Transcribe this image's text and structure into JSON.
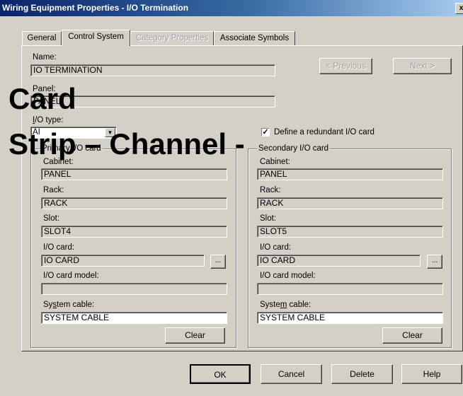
{
  "window": {
    "title": "Wiring Equipment Properties - I/O Termination",
    "close_glyph": "x"
  },
  "tabs": [
    {
      "label": "General",
      "state": "normal"
    },
    {
      "label": "Control System",
      "state": "active"
    },
    {
      "label": "Category Properties",
      "state": "disabled"
    },
    {
      "label": "Associate Symbols",
      "state": "normal"
    }
  ],
  "form": {
    "name_label": "Name:",
    "name_value": "IO TERMINATION",
    "panel_label": "Panel:",
    "panel_value": "PANEL",
    "io_type_label": "I/O type:",
    "io_type_value": "AI",
    "redundant_checkbox_label": "Define a redundant I/O card",
    "redundant_checked": true,
    "previous_button": "< Previous",
    "next_button": "Next >"
  },
  "primary": {
    "legend": "Primary I/O card",
    "cabinet_label": "Cabinet:",
    "cabinet_value": "PANEL",
    "rack_label": "Rack:",
    "rack_value": "RACK",
    "slot_label": "Slot:",
    "slot_value": "SLOT4",
    "io_card_label": "I/O card:",
    "io_card_value": "IO CARD",
    "io_card_model_label": "I/O card model:",
    "io_card_model_value": "",
    "system_cable_label": "System cable:",
    "system_cable_value": "SYSTEM CABLE",
    "browse_button": "...",
    "clear_button": "Clear"
  },
  "secondary": {
    "legend": "Secondary I/O card",
    "cabinet_label": "Cabinet:",
    "cabinet_value": "PANEL",
    "rack_label": "Rack:",
    "rack_value": "RACK",
    "slot_label": "Slot:",
    "slot_value": "SLOT5",
    "io_card_label": "I/O card:",
    "io_card_value": "IO CARD",
    "io_card_model_label": "I/O card model:",
    "io_card_model_value": "",
    "system_cable_label": "System cable:",
    "system_cable_value": "SYSTEM CABLE",
    "browse_button": "...",
    "clear_button": "Clear"
  },
  "footer": {
    "ok_button": "OK",
    "cancel_button": "Cancel",
    "delete_button": "Delete",
    "help_button": "Help"
  },
  "overlay_text": {
    "line1": "Card",
    "line2": "Strip – Channel -"
  }
}
